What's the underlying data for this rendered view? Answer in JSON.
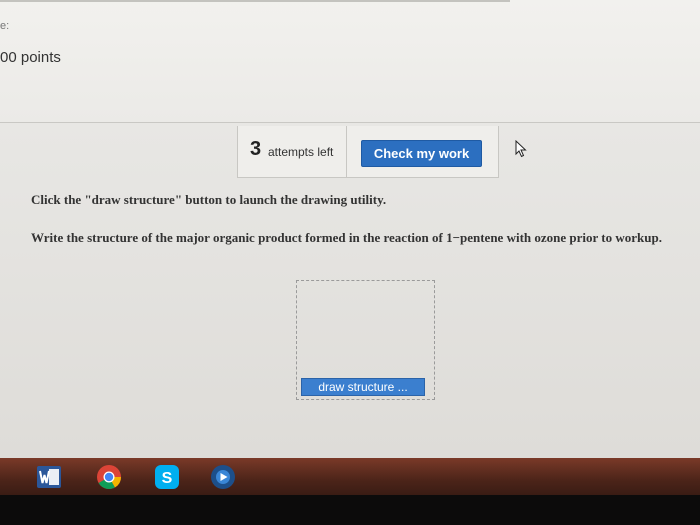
{
  "question": {
    "label": "e:",
    "points": "00 points"
  },
  "attempts": {
    "count": "3",
    "text": "attempts left",
    "check_button": "Check my work"
  },
  "instructions": {
    "line1": "Click the \"draw structure\" button to launch the drawing utility.",
    "line2": "Write the structure of the major organic product formed in the reaction of 1−pentene with ozone prior to workup."
  },
  "answer": {
    "draw_button": "draw structure ..."
  },
  "taskbar": {
    "icons": [
      "word-icon",
      "chrome-icon",
      "skype-icon",
      "media-player-icon"
    ],
    "colors": {
      "word": "#2b579a",
      "chrome_red": "#db4437",
      "chrome_yellow": "#f4b400",
      "chrome_green": "#0f9d58",
      "chrome_blue": "#4285f4",
      "skype": "#00aff0"
    }
  },
  "colors": {
    "accent_button": "#2c6fc0",
    "taskbar": "#5a2b1e"
  }
}
